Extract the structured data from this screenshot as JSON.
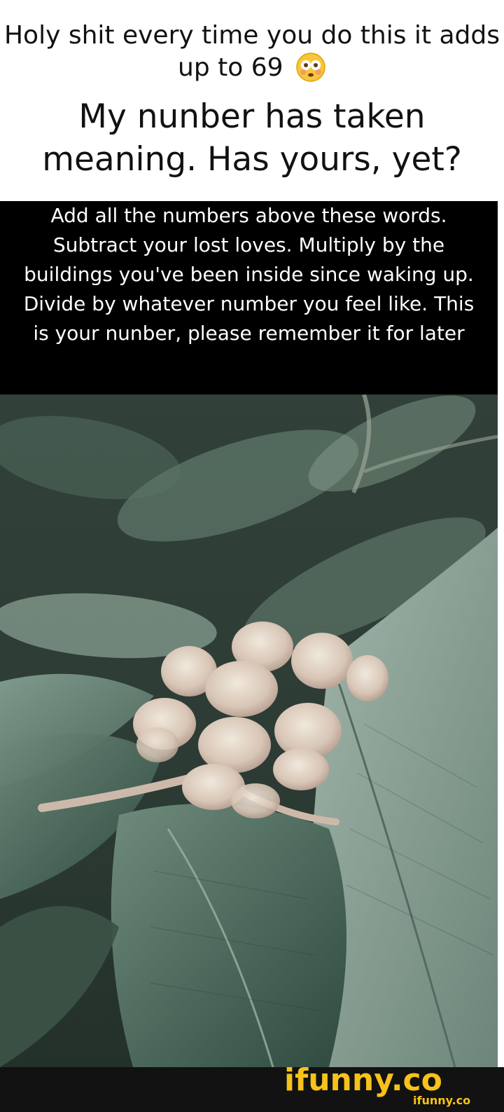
{
  "caption": {
    "line1": "Holy shit every time you do this it adds up to 69",
    "emoji": "flushed-face-emoji",
    "line2": "My nunber has taken meaning. Has yours, yet?"
  },
  "instructions": {
    "text": "Add all the numbers above these words. Subtract your lost loves. Multiply by the buildings you've been inside since waking up. Divide by whatever number you feel like. This is your nunber, please remember it for later"
  },
  "photo": {
    "subject": "plant-with-flower-buds-image"
  },
  "watermark": {
    "logo_text": "ifunny.co",
    "small_text": "ifunny.co",
    "colors": {
      "logo_yellow": "#f6c21b",
      "bar": "#121212"
    }
  }
}
